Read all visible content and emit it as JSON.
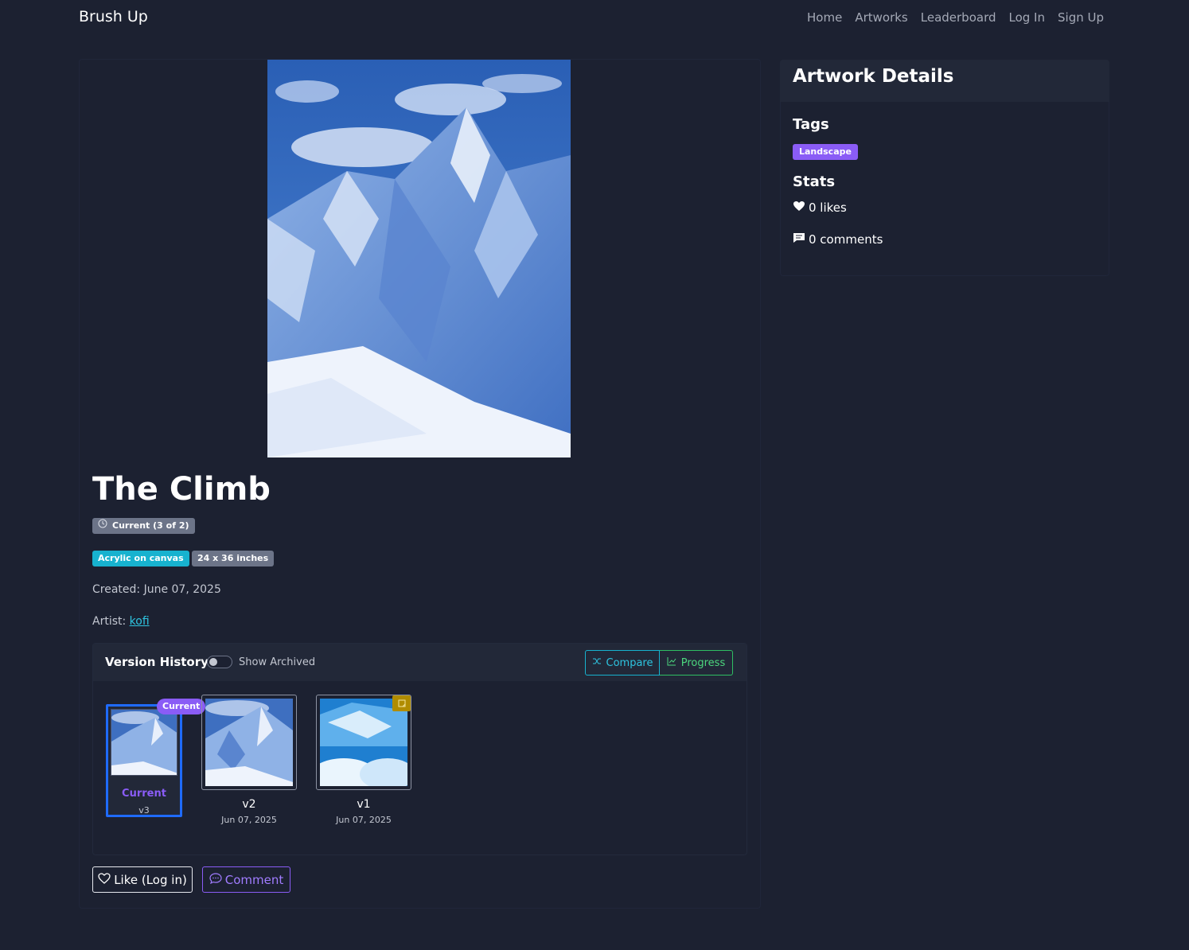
{
  "nav": {
    "brand": "Brush Up",
    "links": [
      "Home",
      "Artworks",
      "Leaderboard",
      "Log In",
      "Sign Up"
    ]
  },
  "artwork": {
    "title": "The Climb",
    "version_badge": "Current (3 of 2)",
    "medium": "Acrylic on canvas",
    "size": "24 x 36 inches",
    "created_label": "Created:",
    "created_value": "June 07, 2025",
    "artist_label": "Artist:",
    "artist_name": "kofi"
  },
  "version_history": {
    "title": "Version History",
    "toggle_label": "Show Archived",
    "compare_label": "Compare",
    "progress_label": "Progress",
    "current_pill": "Current",
    "current": {
      "label": "Current",
      "version": "v3"
    },
    "versions": [
      {
        "label": "v2",
        "date": "Jun 07, 2025"
      },
      {
        "label": "v1",
        "date": "Jun 07, 2025"
      }
    ]
  },
  "actions": {
    "like_label": "Like (Log in)",
    "comment_label": "Comment"
  },
  "sidebar": {
    "title": "Artwork Details",
    "tags_heading": "Tags",
    "tags": [
      "Landscape"
    ],
    "stats_heading": "Stats",
    "likes": "0 likes",
    "comments": "0 comments"
  },
  "colors": {
    "background": "#1c2131",
    "accent_purple": "#8a5cf6",
    "accent_cyan": "#17b2cf",
    "accent_green": "#2fbf63",
    "accent_blue": "#1f6bff"
  }
}
